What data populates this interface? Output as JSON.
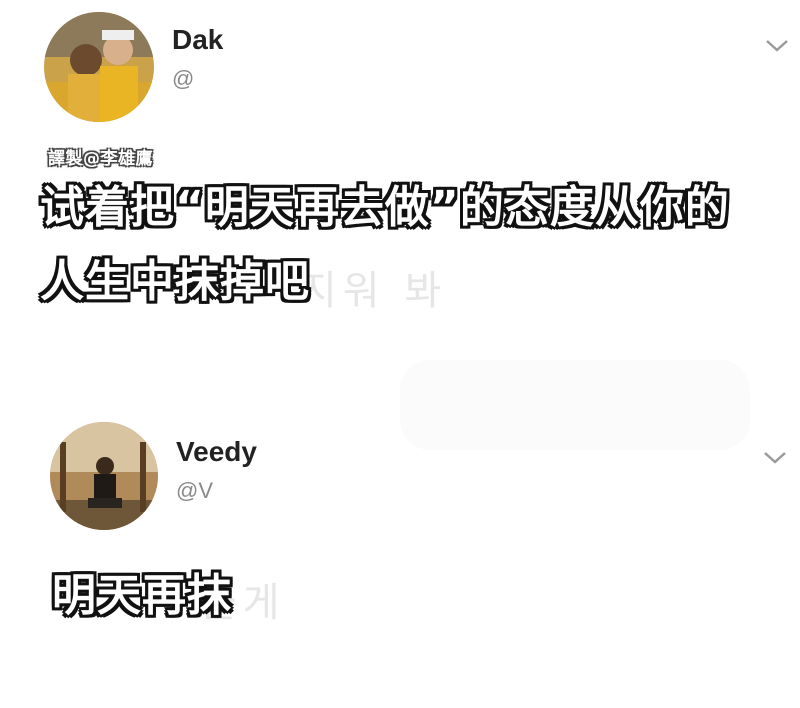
{
  "watermark": "譯製@李雄鷹",
  "posts": [
    {
      "display_name": "Dak",
      "handle": "@",
      "subtitle_lines": [
        "试着把“明天再去做”的态度从你的",
        "人生中抹掉吧"
      ],
      "ghost_text": "지워 봐",
      "avatar_icon": "profile-photo-couple",
      "menu_icon": "chevron-down-icon"
    },
    {
      "display_name": "Veedy",
      "handle": "@V",
      "subtitle_lines": [
        "明天再抹"
      ],
      "ghost_text": "울게",
      "avatar_icon": "profile-photo-person-sitting",
      "menu_icon": "chevron-down-icon"
    }
  ],
  "colors": {
    "background": "#ffffff",
    "name_text": "#222222",
    "handle_text": "#8a8a8a",
    "subtitle_fill": "#ffffff",
    "subtitle_outline": "#111111"
  }
}
